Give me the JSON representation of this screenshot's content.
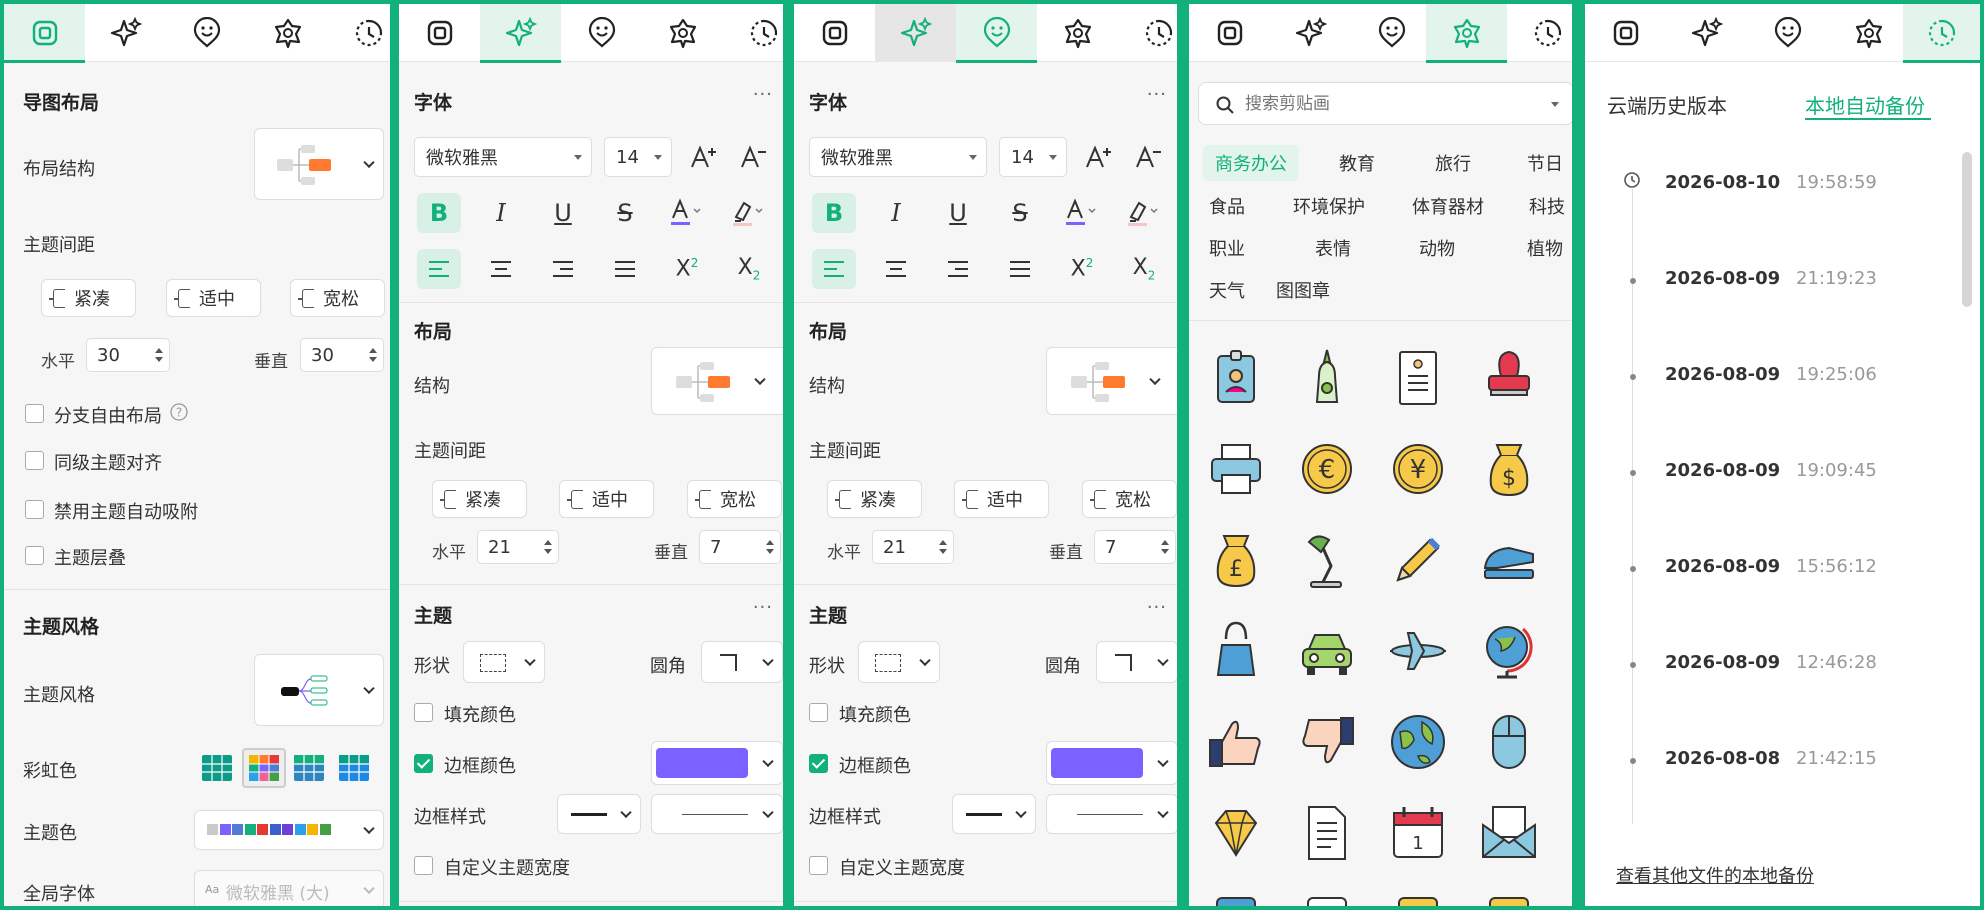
{
  "colors": {
    "accent": "#12b07a",
    "border_color_swatch": "#7b61ff"
  },
  "tabs": [
    "layout-icon",
    "sparkle-icon",
    "emoji-icon",
    "sticker-icon",
    "history-icon"
  ],
  "p1": {
    "section_layout": "导图布局",
    "layout_structure_label": "布局结构",
    "topic_spacing_label": "主题间距",
    "spacing_options": [
      "紧凑",
      "适中",
      "宽松"
    ],
    "horizontal_label": "水平",
    "horizontal_value": "30",
    "vertical_label": "垂直",
    "vertical_value": "30",
    "checks": [
      "分支自由布局",
      "同级主题对齐",
      "禁用主题自动吸附",
      "主题层叠"
    ],
    "section_style": "主题风格",
    "theme_style_label": "主题风格",
    "rainbow_label": "彩虹色",
    "theme_color_label": "主题色",
    "theme_colors": [
      "#c9c9c9",
      "#7b61ff",
      "#4e7dd6",
      "#12b07a",
      "#e53935",
      "#3a5fcd",
      "#6c3fd6",
      "#2aa1e8",
      "#f5b400",
      "#43a047"
    ],
    "global_font_label": "全局字体",
    "global_font_value": "微软雅黑 (大)"
  },
  "p2": {
    "section_font": "字体",
    "font_family": "微软雅黑",
    "font_size": "14",
    "section_layout": "布局",
    "structure_label": "结构",
    "topic_spacing_label": "主题间距",
    "spacing_options": [
      "紧凑",
      "适中",
      "宽松"
    ],
    "horizontal_label": "水平",
    "horizontal_value": "21",
    "vertical_label": "垂直",
    "vertical_value": "7",
    "section_topic": "主题",
    "shape_label": "形状",
    "corner_label": "圆角",
    "fill_label": "填充颜色",
    "border_color_label": "边框颜色",
    "border_style_label": "边框样式",
    "custom_width_label": "自定义主题宽度"
  },
  "p4": {
    "search_placeholder": "搜索剪贴画",
    "categories": [
      "商务办公",
      "教育",
      "旅行",
      "节日",
      "食品",
      "环境保护",
      "体育器材",
      "科技",
      "职业",
      "表情",
      "动物",
      "植物",
      "天气",
      "图图章"
    ]
  },
  "p5": {
    "tab_cloud": "云端历史版本",
    "tab_local": "本地自动备份",
    "entries": [
      {
        "date": "2026-08-10",
        "time": "19:58:59"
      },
      {
        "date": "2026-08-09",
        "time": "21:19:23"
      },
      {
        "date": "2026-08-09",
        "time": "19:25:06"
      },
      {
        "date": "2026-08-09",
        "time": "19:09:45"
      },
      {
        "date": "2026-08-09",
        "time": "15:56:12"
      },
      {
        "date": "2026-08-09",
        "time": "12:46:28"
      },
      {
        "date": "2026-08-08",
        "time": "21:42:15"
      }
    ],
    "footer_link": "查看其他文件的本地备份"
  }
}
